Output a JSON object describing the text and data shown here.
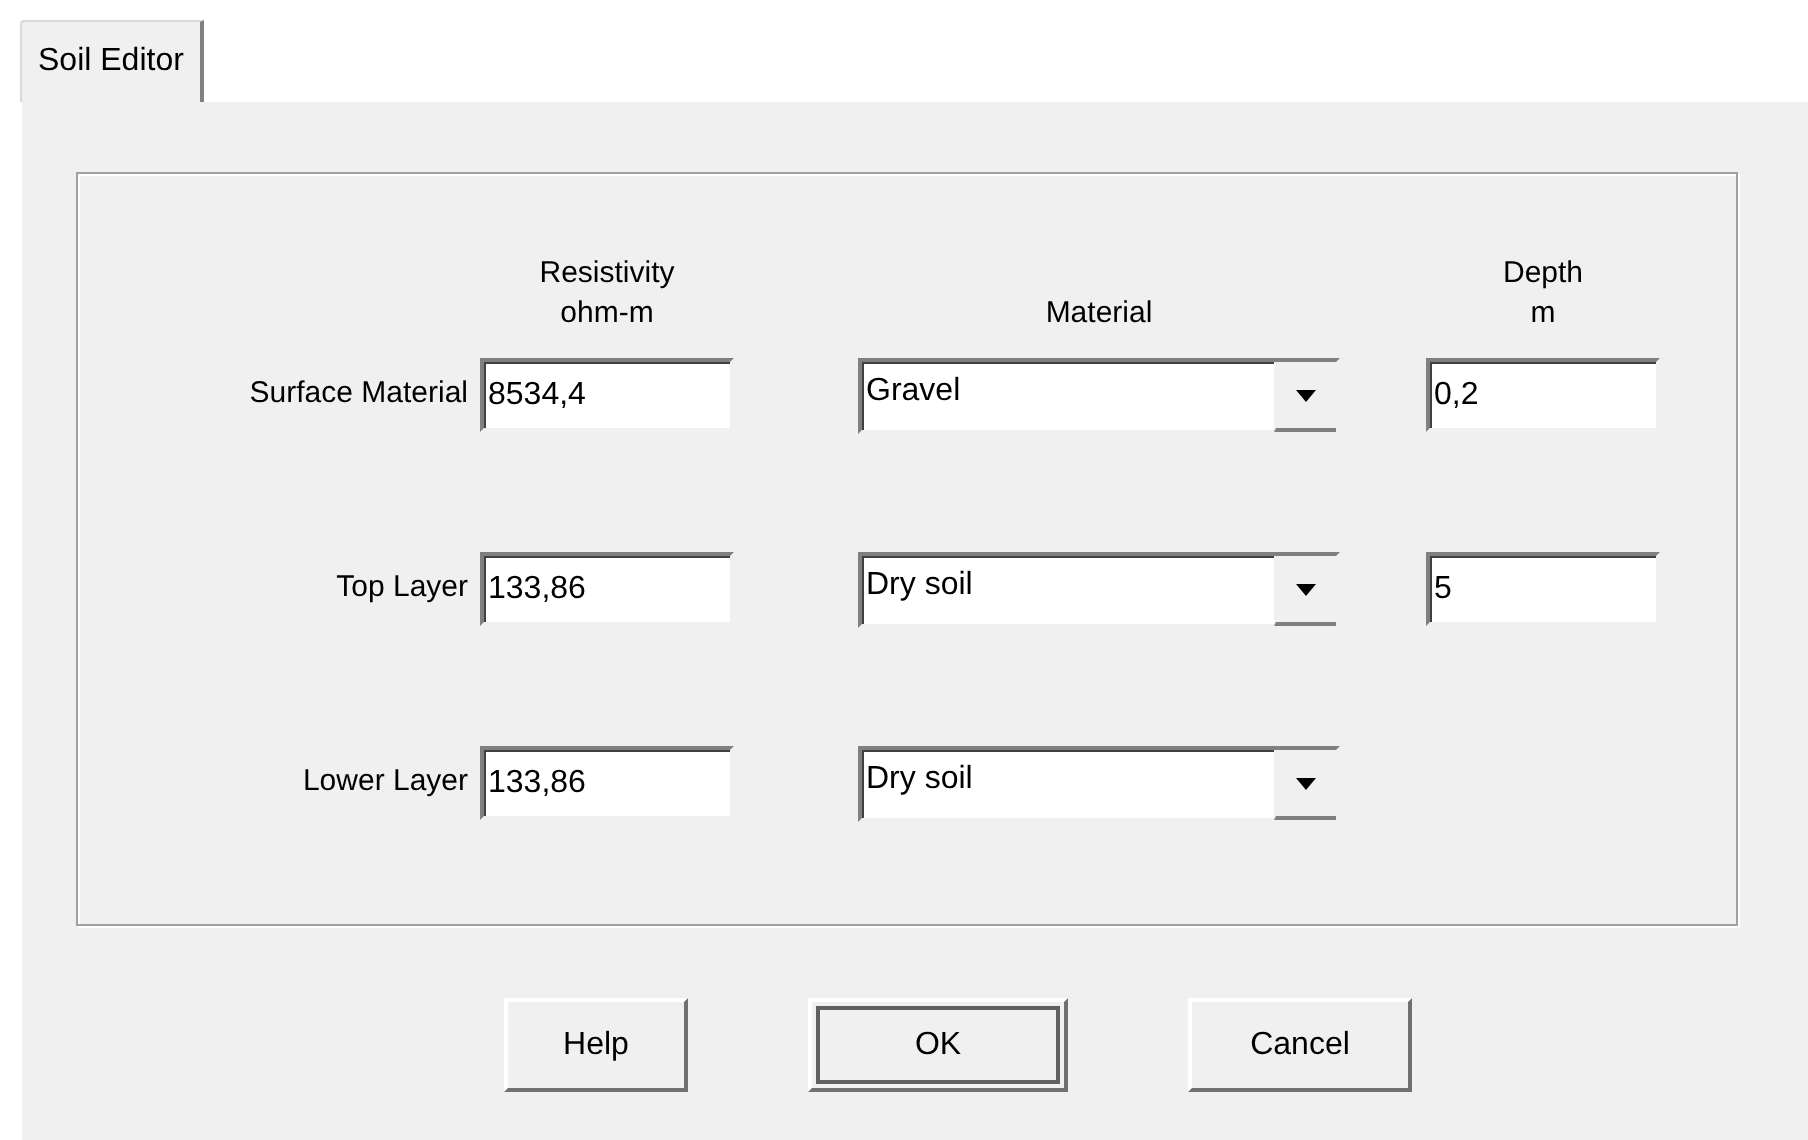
{
  "tabs": [
    {
      "label": "Soil Editor",
      "selected": true
    }
  ],
  "headers": {
    "resistivity": [
      "Resistivity",
      "ohm-m"
    ],
    "material": [
      "Material"
    ],
    "depth": [
      "Depth",
      "m"
    ]
  },
  "rows": [
    {
      "label": "Surface Material",
      "resistivity": "8534,4",
      "material": "Gravel",
      "depth": "0,2"
    },
    {
      "label": "Top Layer",
      "resistivity": "133,86",
      "material": "Dry soil",
      "depth": "5"
    },
    {
      "label": "Lower Layer",
      "resistivity": "133,86",
      "material": "Dry soil"
    }
  ],
  "buttons": [
    {
      "label": "Help",
      "default": false
    },
    {
      "label": "OK",
      "default": true
    },
    {
      "label": "Cancel",
      "default": false
    }
  ]
}
